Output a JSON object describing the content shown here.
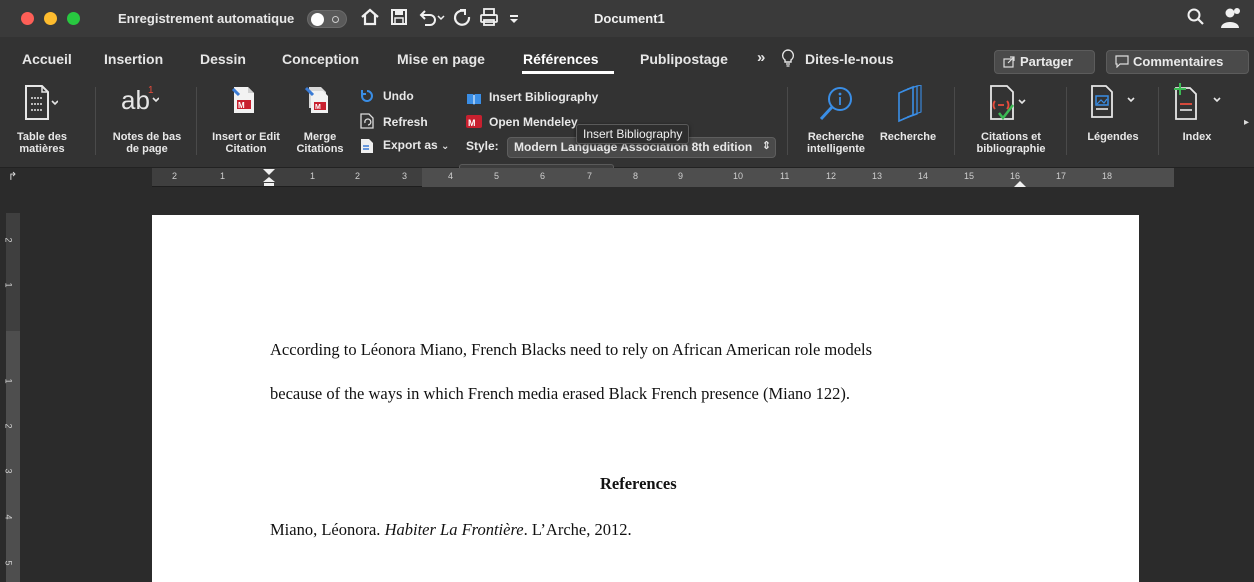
{
  "titlebar": {
    "autosave_label": "Enregistrement automatique",
    "doc_title": "Document1",
    "icons": [
      "home-icon",
      "save-icon",
      "undo-icon",
      "redo-icon",
      "print-icon",
      "customize-icon",
      "search-icon",
      "account-icon"
    ]
  },
  "tabs": {
    "items": [
      "Accueil",
      "Insertion",
      "Dessin",
      "Conception",
      "Mise en page",
      "Références",
      "Publipostage"
    ],
    "active": "Références",
    "overflow": "»",
    "tell_me": "Dites-le-nous",
    "share": "Partager",
    "comments": "Commentaires"
  },
  "ribbon": {
    "toc": "Table des matières",
    "footnotes": "Notes de bas de page",
    "insert_edit_citation": "Insert or Edit Citation",
    "merge_citations": "Merge Citations",
    "undo": "Undo",
    "refresh": "Refresh",
    "export_as": "Export as",
    "insert_bibliography": "Insert Bibliography",
    "open_mendeley": "Open Mendeley",
    "style_label": "Style:",
    "style_value": "Modern Language Association 8th edition",
    "tooltip": "Insert Bibliography",
    "smart_lookup": "Recherche intelligente",
    "researcher": "Recherche",
    "citations_bib": "Citations et bibliographie",
    "captions": "Légendes",
    "index": "Index"
  },
  "ruler": {
    "numbers": [
      "2",
      "1",
      "1",
      "2",
      "3",
      "4",
      "5",
      "6",
      "7",
      "8",
      "9",
      "10",
      "11",
      "12",
      "13",
      "14",
      "15",
      "16",
      "17",
      "18"
    ],
    "vertical_numbers": [
      "2",
      "1",
      "1",
      "2",
      "3",
      "4",
      "5"
    ]
  },
  "document": {
    "para_line1": "According to Léonora Miano, French Blacks need to rely on African American role models",
    "para_line2": "because of the ways in which French media erased Black French presence (Miano 122).",
    "ref_heading": "References",
    "bib_author": "Miano, Léonora. ",
    "bib_title": "Habiter La Frontière",
    "bib_rest": ". L’Arche, 2012."
  },
  "colors": {
    "accent": "#ffffff",
    "mendeley_red": "#c8202f",
    "traffic_close": "#fe5f57",
    "traffic_min": "#febc2e",
    "traffic_max": "#28c840"
  }
}
